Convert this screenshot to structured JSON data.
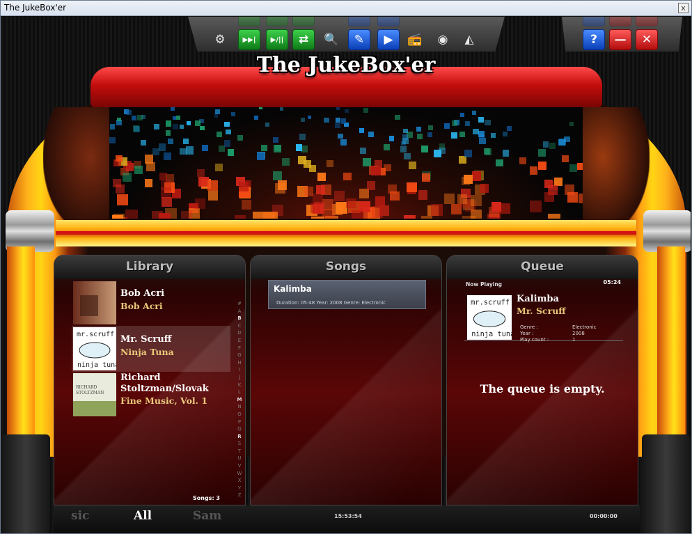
{
  "window": {
    "title": "The JukeBox'er",
    "close_glyph": "x"
  },
  "toolbar": {
    "main": [
      {
        "name": "settings-icon",
        "glyph": "⚙",
        "style": "n"
      },
      {
        "name": "skip-icon",
        "glyph": "▶▶|",
        "style": "g"
      },
      {
        "name": "play-pause-icon",
        "glyph": "▶/||",
        "style": "g"
      },
      {
        "name": "shuffle-icon",
        "glyph": "⇄",
        "style": "g"
      },
      {
        "name": "search-icon",
        "glyph": "🔍",
        "style": "n"
      },
      {
        "name": "edit-playlist-icon",
        "glyph": "✎",
        "style": "b"
      },
      {
        "name": "play-file-icon",
        "glyph": "▶",
        "style": "b"
      },
      {
        "name": "radio-icon",
        "glyph": "📻",
        "style": "n"
      },
      {
        "name": "cd-icon",
        "glyph": "◉",
        "style": "n"
      },
      {
        "name": "visualizer-icon",
        "glyph": "◭",
        "style": "n"
      }
    ],
    "window": [
      {
        "name": "help-icon",
        "glyph": "?",
        "style": "b"
      },
      {
        "name": "minimize-icon",
        "glyph": "—",
        "style": "r"
      },
      {
        "name": "close-icon",
        "glyph": "✕",
        "style": "r"
      }
    ]
  },
  "logo": "The JukeBox'er",
  "library": {
    "title": "Library",
    "items": [
      {
        "artist": "Bob Acri",
        "album": "Bob Acri",
        "thumb": "cover-bob-acri"
      },
      {
        "artist": "Mr. Scruff",
        "album": "Ninja Tuna",
        "thumb": "cover-ninja-tuna"
      },
      {
        "artist": "Richard Stoltzman/Slovak",
        "album": "Fine Music, Vol. 1",
        "thumb": "cover-fine-music"
      }
    ],
    "alphabet": [
      "#",
      "A",
      "B",
      "C",
      "D",
      "E",
      "F",
      "G",
      "H",
      "I",
      "J",
      "K",
      "L",
      "M",
      "N",
      "O",
      "P",
      "Q",
      "R",
      "S",
      "T",
      "U",
      "V",
      "W",
      "X",
      "Y",
      "Z"
    ],
    "alphabet_active": [
      "B",
      "M",
      "R"
    ],
    "song_count": "Songs: 3"
  },
  "songs": {
    "title": "Songs",
    "items": [
      {
        "title": "Kalimba",
        "details": "Duration: 05:48   Year: 2008   Genre: Electronic"
      }
    ]
  },
  "queue": {
    "title": "Queue",
    "now_playing_label": "Now Playing",
    "elapsed": "05:24",
    "track": "Kalimba",
    "artist": "Mr. Scruff",
    "genre_label": "Genre :",
    "genre": "Electronic",
    "year_label": "Year :",
    "year": "2008",
    "playcount_label": "Play count :",
    "playcount": "1",
    "empty_message": "The queue is empty."
  },
  "bottom": {
    "filter_left": "sic",
    "filter_active": "All",
    "filter_right": "Sam",
    "clock": "15:53:54",
    "time": "00:00:00"
  },
  "colors": {
    "accent_gold": "#e9c879",
    "frame_red": "#c40d0d",
    "frame_yellow": "#ffd515"
  }
}
